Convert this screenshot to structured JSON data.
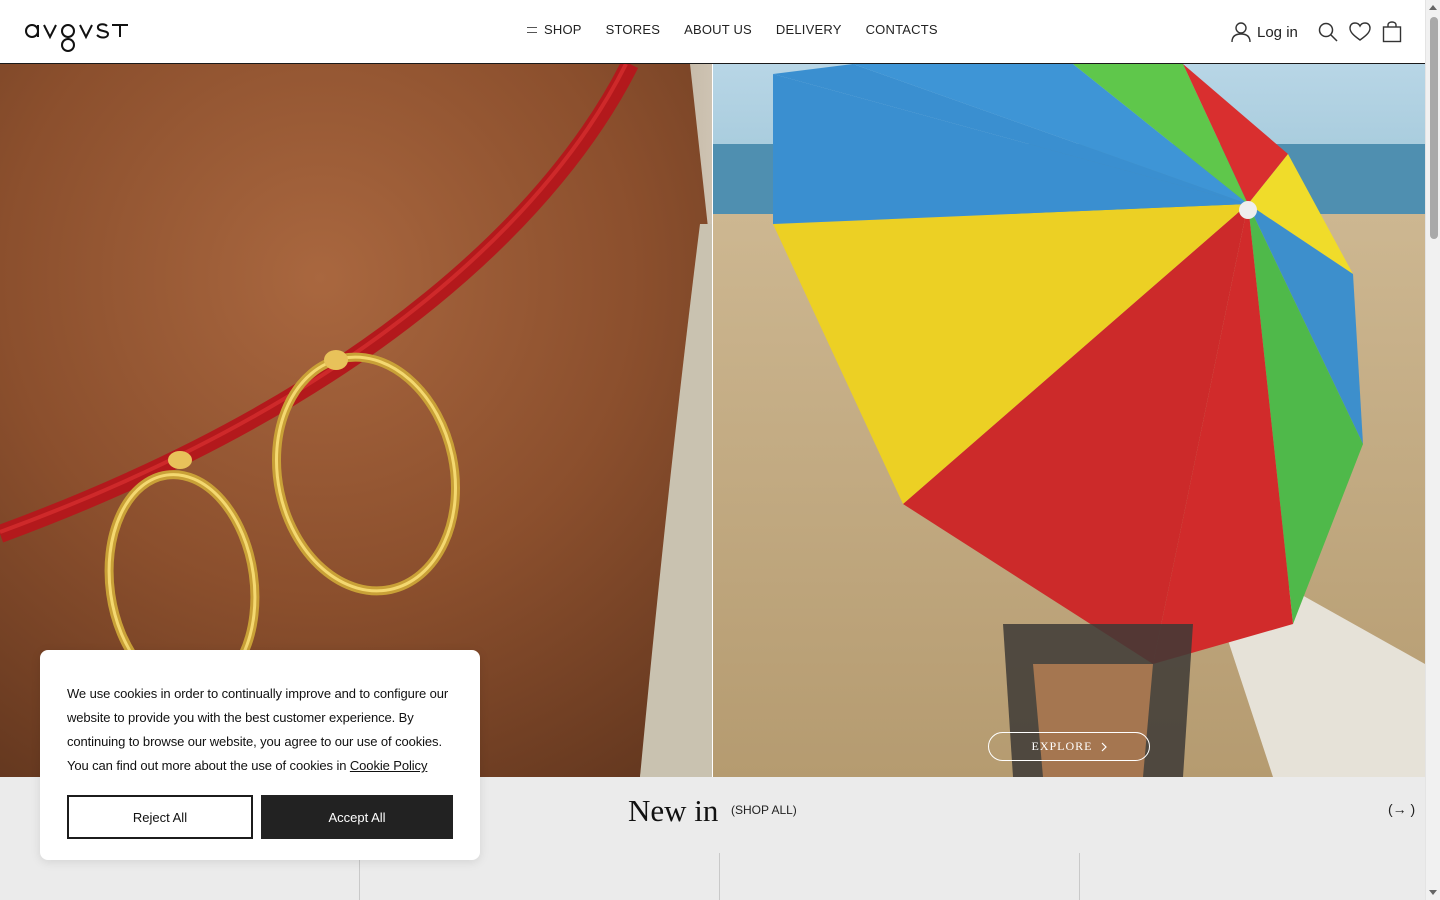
{
  "brand": {
    "logo_text": "avgvst"
  },
  "nav": {
    "items": [
      {
        "label": "SHOP"
      },
      {
        "label": "STORES"
      },
      {
        "label": "ABOUT US"
      },
      {
        "label": "DELIVERY"
      },
      {
        "label": "CONTACTS"
      }
    ]
  },
  "header": {
    "login_label": "Log in",
    "icons": [
      "user-icon",
      "search-icon",
      "heart-icon",
      "bag-icon"
    ]
  },
  "hero": {
    "left_image": "earrings-photo",
    "right_image": "beach-umbrella-photo",
    "explore_label": "EXPLORE"
  },
  "newin": {
    "title": "New in",
    "shop_all": "(SHOP ALL)",
    "arrow": "(→ )"
  },
  "cookie": {
    "text": "We use cookies in order to continually improve and to configure our website to provide you with the best customer experience. By continuing to browse our website, you agree to our use of cookies. You can find out more about the use of cookies in",
    "link": "Cookie Policy",
    "reject": "Reject All",
    "accept": "Accept All"
  },
  "colors": {
    "accent": "#222222",
    "panel": "#ebebeb"
  }
}
